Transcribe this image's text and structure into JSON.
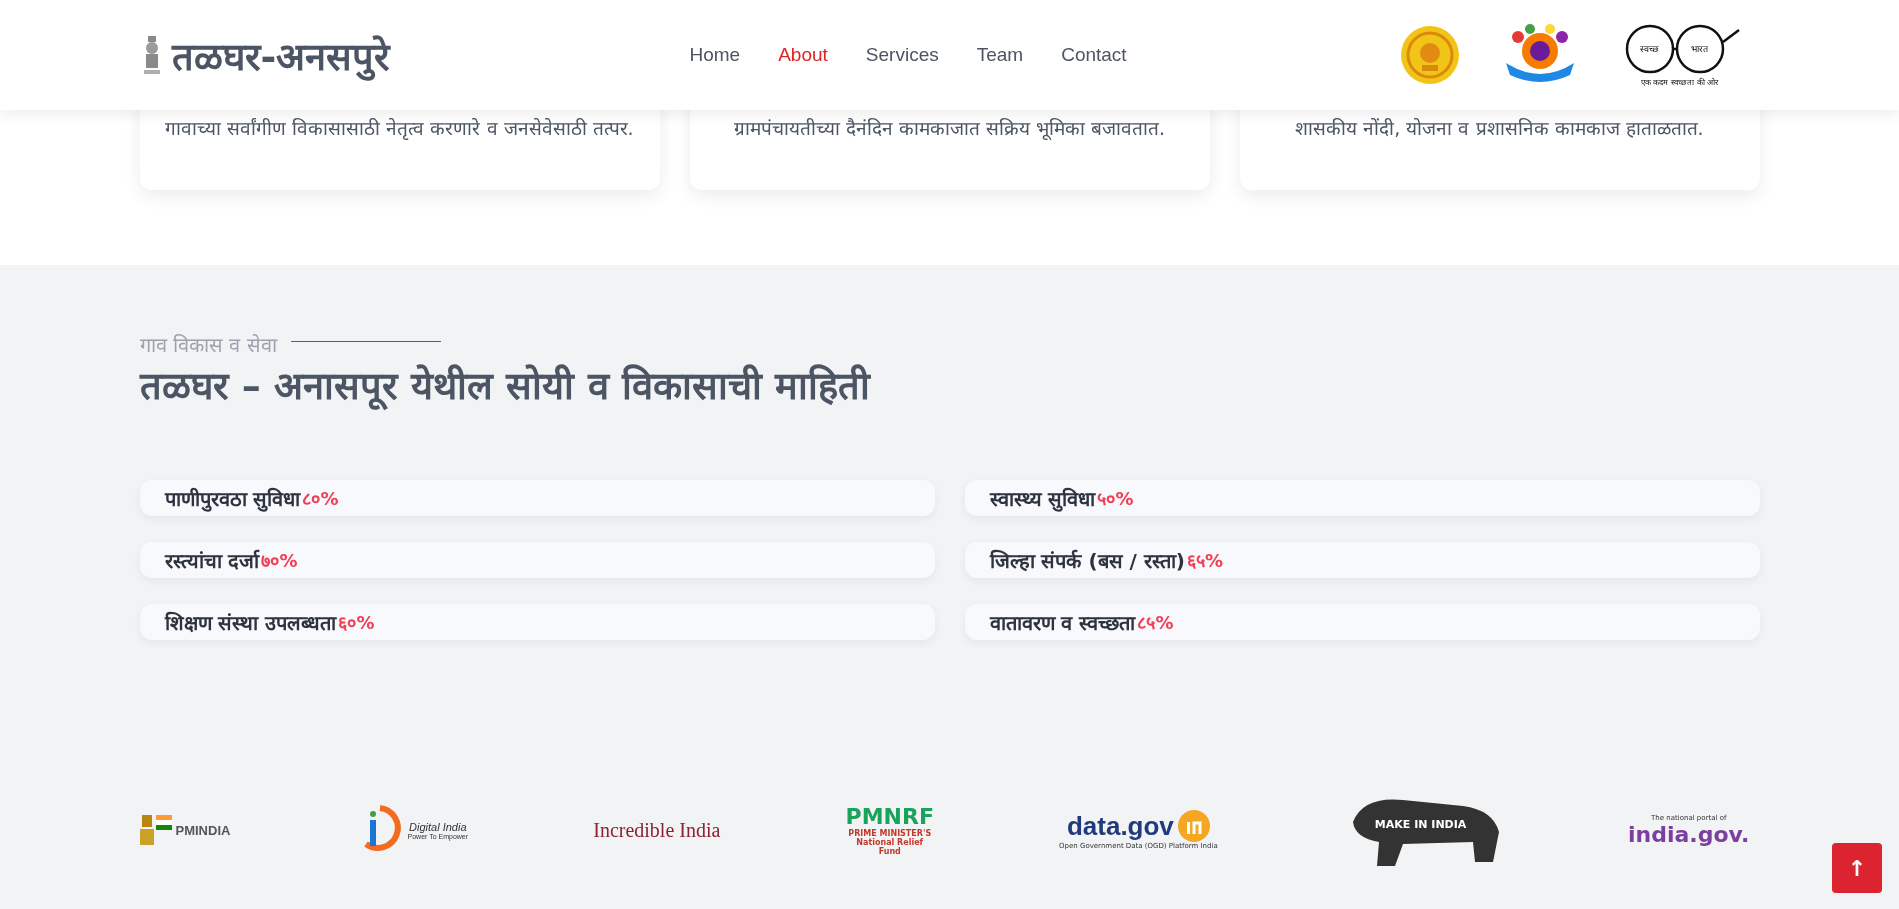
{
  "header": {
    "brand": "तळघर-अनसपुरे",
    "nav": [
      {
        "label": "Home",
        "selected": false
      },
      {
        "label": "About",
        "selected": true
      },
      {
        "label": "Services",
        "selected": false
      },
      {
        "label": "Team",
        "selected": false
      },
      {
        "label": "Contact",
        "selected": false
      }
    ],
    "logos": [
      {
        "kind": "seal"
      },
      {
        "kind": "badge"
      },
      {
        "kind": "spectacles",
        "texts": [
          "स्वच्छ",
          "भारत",
          "एक कदम स्वच्छता की ओर"
        ]
      }
    ]
  },
  "cards": [
    {
      "text": "गावाच्या सर्वांगीण विकासासाठी नेतृत्व करणारे व जनसेवेसाठी तत्पर."
    },
    {
      "text": "ग्रामपंचायतीच्या दैनंदिन कामकाजात सक्रिय भूमिका बजावतात."
    },
    {
      "text": "शासकीय नोंदी, योजना व प्रशासनिक कामकाज हाताळतात."
    }
  ],
  "section": {
    "subtitle": "गाव विकास व सेवा",
    "title": "तळघर – अनासपूर येथील सोयी व विकासाची माहिती",
    "facilities": [
      {
        "label": "पाणीपुरवठा सुविधा",
        "value": "८०%"
      },
      {
        "label": "स्वास्थ्य सुविधा",
        "value": "५०%"
      },
      {
        "label": "रस्त्यांचा दर्जा",
        "value": "७०%"
      },
      {
        "label": "जिल्हा संपर्क (बस / रस्ता)",
        "value": "६५%"
      },
      {
        "label": "शिक्षण संस्था उपलब्धता",
        "value": "६०%"
      },
      {
        "label": "वातावरण व स्वच्छता",
        "value": "८५%"
      }
    ]
  },
  "partners": [
    {
      "kind": "pmindia",
      "name": "PMINDIA"
    },
    {
      "kind": "digital",
      "name": "Digital India",
      "tagline": "Power To Empower"
    },
    {
      "kind": "incredible",
      "name": "Incredible India"
    },
    {
      "kind": "pmnrf",
      "name": "PMNRF",
      "tagline": "PRIME MINISTER'S National Relief Fund"
    },
    {
      "kind": "datagov",
      "name": "data.gov",
      "tagline": "Open Government Data (OGD) Platform India"
    },
    {
      "kind": "makeinindia",
      "name": "MAKE IN INDIA"
    },
    {
      "kind": "indiagov",
      "name": "india.gov.",
      "tagline": "The national portal of"
    }
  ],
  "back_to_top": {
    "icon": "↑"
  }
}
